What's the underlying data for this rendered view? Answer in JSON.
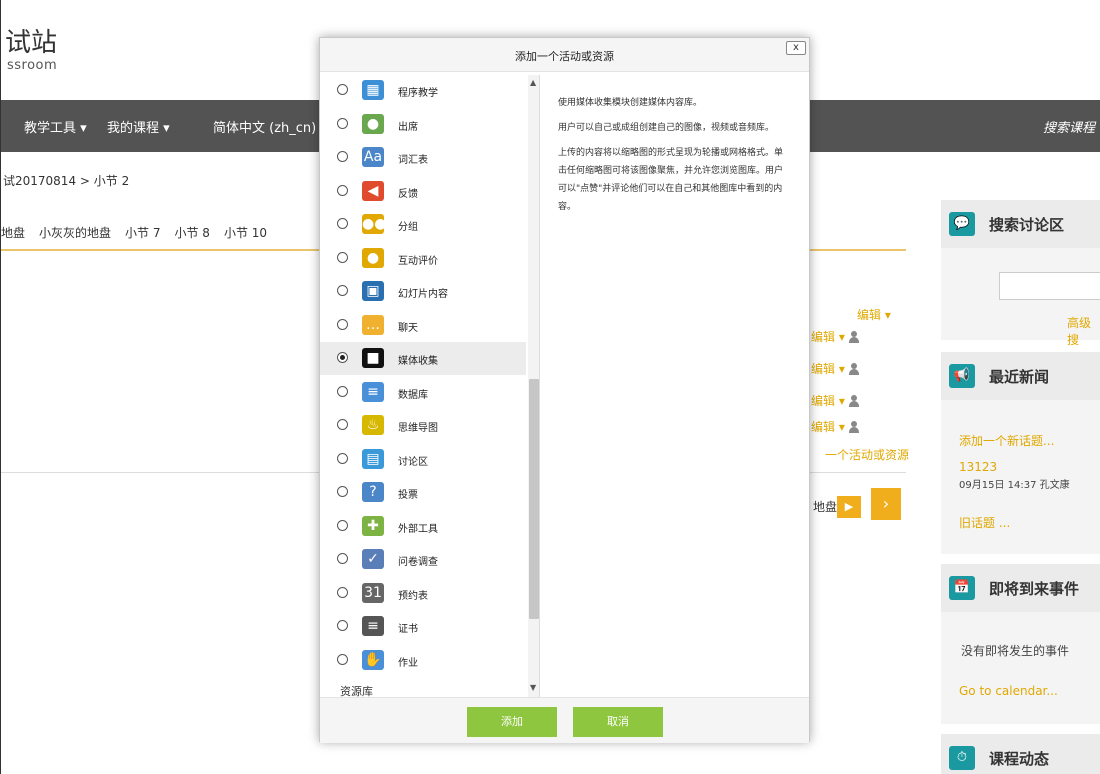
{
  "page": {
    "site_title": "试站",
    "site_subtitle": "ssroom",
    "nav": [
      "教学工具 ▾",
      "我的课程 ▾",
      "简体中文 (zh_cn) ▾"
    ],
    "nav_search": "搜索课程",
    "breadcrumb": "试20170814 > 小节 2",
    "tabs": [
      "地盘",
      "小灰灰的地盘",
      "小节 7",
      "小节 8",
      "小节 10"
    ],
    "edit_main": "编辑 ▾",
    "edit_item": "编辑 ▾",
    "add_resource_link": "一个活动或资源",
    "next_nav_text": "地盘",
    "arrow_small": "▶",
    "arrow_large": "›"
  },
  "blocks": {
    "search_forum": {
      "title": "搜索讨论区",
      "icon": "💬",
      "advanced": "高级搜"
    },
    "news": {
      "title": "最近新闻",
      "icon": "📢",
      "add_topic": "添加一个新话题...",
      "item_title": "13123",
      "item_meta": "09月15日 14:37 孔文康",
      "older": "旧话题 ..."
    },
    "events": {
      "title": "即将到来事件",
      "icon": "📅",
      "empty": "没有即将发生的事件",
      "calendar": "Go to calendar..."
    },
    "activity": {
      "title": "课程动态",
      "icon": "⏱"
    }
  },
  "modal": {
    "title": "添加一个活动或资源",
    "close": "x",
    "options": [
      {
        "label": "程序教学",
        "icon": "▦",
        "color": "#3d8fd6"
      },
      {
        "label": "出席",
        "icon": "●",
        "color": "#6aa84f"
      },
      {
        "label": "词汇表",
        "icon": "Aa",
        "color": "#4a86c8"
      },
      {
        "label": "反馈",
        "icon": "◀",
        "color": "#e04a2f"
      },
      {
        "label": "分组",
        "icon": "●●",
        "color": "#e0a800"
      },
      {
        "label": "互动评价",
        "icon": "●",
        "color": "#e0a800"
      },
      {
        "label": "幻灯片内容",
        "icon": "▣",
        "color": "#2a6fb0"
      },
      {
        "label": "聊天",
        "icon": "…",
        "color": "#f0b030"
      },
      {
        "label": "媒体收集",
        "icon": "■",
        "color": "#111111"
      },
      {
        "label": "数据库",
        "icon": "≡",
        "color": "#4a90d9"
      },
      {
        "label": "思维导图",
        "icon": "♨",
        "color": "#d6b800"
      },
      {
        "label": "讨论区",
        "icon": "▤",
        "color": "#3a9ad9"
      },
      {
        "label": "投票",
        "icon": "?",
        "color": "#4a86c8"
      },
      {
        "label": "外部工具",
        "icon": "✚",
        "color": "#7cb342"
      },
      {
        "label": "问卷调查",
        "icon": "✓",
        "color": "#5a7fb8"
      },
      {
        "label": "预约表",
        "icon": "31",
        "color": "#666666"
      },
      {
        "label": "证书",
        "icon": "≡",
        "color": "#555555"
      },
      {
        "label": "作业",
        "icon": "✋",
        "color": "#4a90d9"
      }
    ],
    "selected_index": 8,
    "section_label": "资源库",
    "description": [
      "使用媒体收集模块创建媒体内容库。",
      "用户可以自己或成组创建自己的图像，视频或音频库。",
      "上传的内容将以缩略图的形式呈现为轮播或网格格式。单击任何缩略图可将该图像聚焦，并允许您浏览图库。用户可以\"点赞\"并评论他们可以在自己和其他图库中看到的内容。"
    ],
    "add_button": "添加",
    "cancel_button": "取消"
  }
}
